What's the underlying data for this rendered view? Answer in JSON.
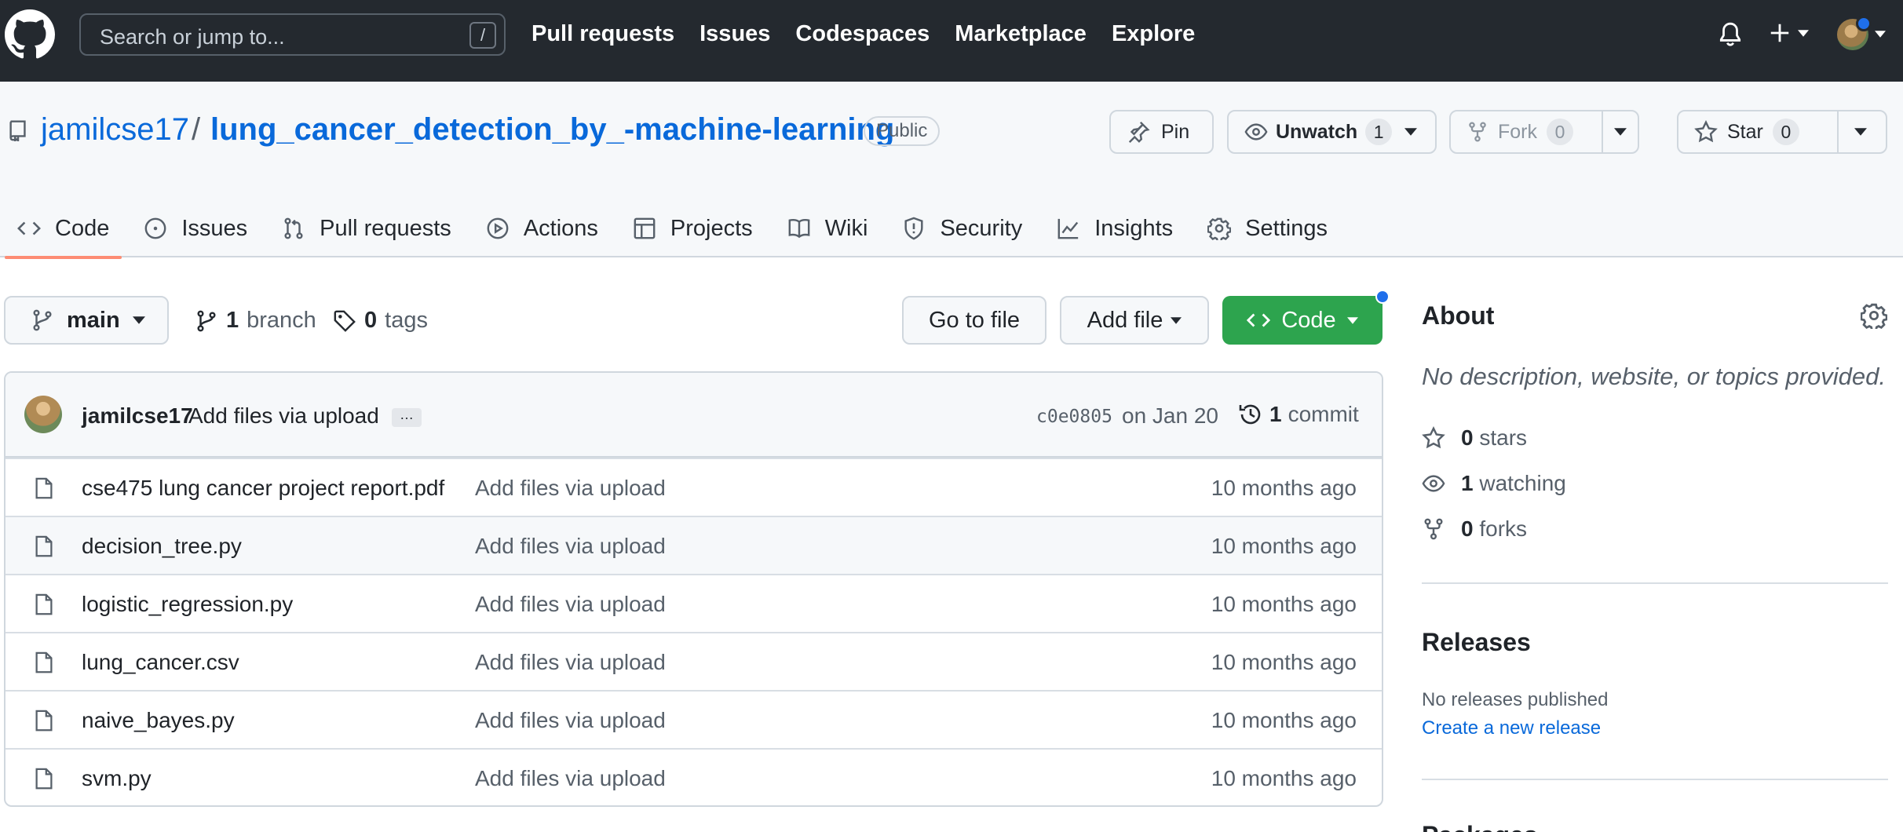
{
  "topnav": {
    "search_placeholder": "Search or jump to...",
    "search_shortcut": "/",
    "links": [
      "Pull requests",
      "Issues",
      "Codespaces",
      "Marketplace",
      "Explore"
    ]
  },
  "repo": {
    "owner": "jamilcse17",
    "separator": "/",
    "name": "lung_cancer_detection_by_-machine-learning",
    "visibility": "Public",
    "pin_label": "Pin",
    "unwatch_label": "Unwatch",
    "watch_count": "1",
    "fork_label": "Fork",
    "fork_count": "0",
    "star_label": "Star",
    "star_count": "0"
  },
  "tabs": [
    "Code",
    "Issues",
    "Pull requests",
    "Actions",
    "Projects",
    "Wiki",
    "Security",
    "Insights",
    "Settings"
  ],
  "toolbar": {
    "branch": "main",
    "branch_count": "1",
    "branch_label": "branch",
    "tag_count": "0",
    "tag_label": "tags",
    "go_to_file": "Go to file",
    "add_file": "Add file",
    "code": "Code"
  },
  "commit": {
    "author": "jamilcse17",
    "message": "Add files via upload",
    "ellipsis": "…",
    "sha": "c0e0805",
    "date": "on Jan 20",
    "count": "1",
    "count_label": "commit"
  },
  "files": [
    {
      "name": "cse475 lung cancer project report.pdf",
      "message": "Add files via upload",
      "time": "10 months ago"
    },
    {
      "name": "decision_tree.py",
      "message": "Add files via upload",
      "time": "10 months ago"
    },
    {
      "name": "logistic_regression.py",
      "message": "Add files via upload",
      "time": "10 months ago"
    },
    {
      "name": "lung_cancer.csv",
      "message": "Add files via upload",
      "time": "10 months ago"
    },
    {
      "name": "naive_bayes.py",
      "message": "Add files via upload",
      "time": "10 months ago"
    },
    {
      "name": "svm.py",
      "message": "Add files via upload",
      "time": "10 months ago"
    }
  ],
  "about": {
    "title": "About",
    "description": "No description, website, or topics provided.",
    "stars_count": "0",
    "stars_label": "stars",
    "watching_count": "1",
    "watching_label": "watching",
    "forks_count": "0",
    "forks_label": "forks"
  },
  "releases": {
    "title": "Releases",
    "none": "No releases published",
    "create_link": "Create a new release"
  },
  "packages": {
    "title": "Packages"
  },
  "colors": {
    "header_bg": "#24292f",
    "link": "#0969da",
    "code_button": "#2da44e",
    "active_tab_underline": "#fd8c73",
    "notification_dot": "#1f6feb"
  }
}
